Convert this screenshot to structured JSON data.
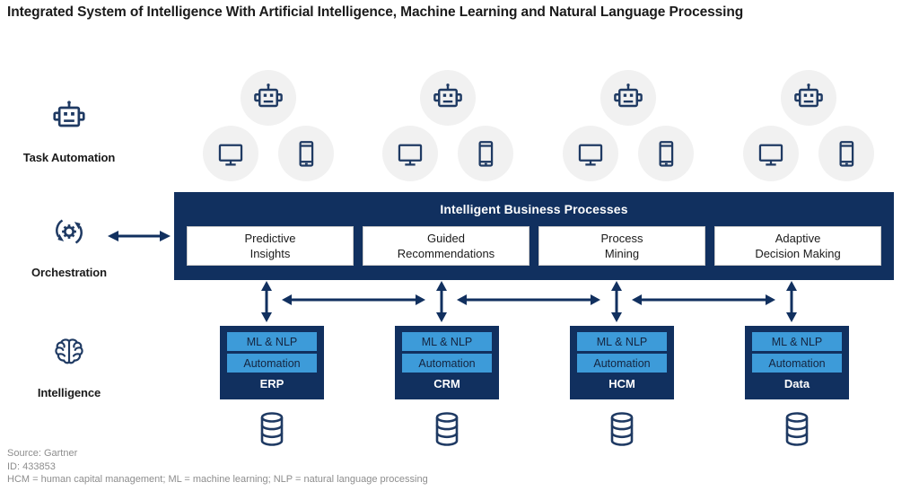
{
  "title": "Integrated System of Intelligence With Artificial Intelligence, Machine Learning and Natural Language Processing",
  "colors": {
    "navy": "#11305f",
    "light_blue": "#3d9bd9",
    "icon_navy": "#1f3a63",
    "circle_bg": "#f1f1f1",
    "footer_gray": "#8d8d8d"
  },
  "rows": [
    {
      "id": "task-automation",
      "label": "Task Automation",
      "icon": "robot-icon"
    },
    {
      "id": "orchestration",
      "label": "Orchestration",
      "icon": "gear-refresh-icon"
    },
    {
      "id": "intelligence",
      "label": "Intelligence",
      "icon": "brain-icon"
    }
  ],
  "device_clusters": [
    {
      "robot": "robot-icon",
      "monitor": "desktop-monitor-icon",
      "phone": "smartphone-icon"
    },
    {
      "robot": "robot-icon",
      "monitor": "desktop-monitor-icon",
      "phone": "smartphone-icon"
    },
    {
      "robot": "robot-icon",
      "monitor": "desktop-monitor-icon",
      "phone": "smartphone-icon"
    },
    {
      "robot": "robot-icon",
      "monitor": "desktop-monitor-icon",
      "phone": "smartphone-icon"
    }
  ],
  "banner": {
    "title": "Intelligent  Business Processes",
    "cards": [
      {
        "line1": "Predictive",
        "line2": "Insights"
      },
      {
        "line1": "Guided",
        "line2": "Recommendations"
      },
      {
        "line1": "Process",
        "line2": "Mining"
      },
      {
        "line1": "Adaptive",
        "line2": "Decision Making"
      }
    ]
  },
  "orchestration_connector": "bidirectional-arrow",
  "arrows": {
    "vertical": [
      "bidirectional-vertical-arrow",
      "bidirectional-vertical-arrow",
      "bidirectional-vertical-arrow",
      "bidirectional-vertical-arrow"
    ],
    "horizontal": [
      "bidirectional-horizontal-arrow",
      "bidirectional-horizontal-arrow",
      "bidirectional-horizontal-arrow"
    ]
  },
  "stacks": [
    {
      "chip1": "ML & NLP",
      "chip2": "Automation",
      "name": "ERP",
      "database": "database-icon"
    },
    {
      "chip1": "ML & NLP",
      "chip2": "Automation",
      "name": "CRM",
      "database": "database-icon"
    },
    {
      "chip1": "ML & NLP",
      "chip2": "Automation",
      "name": "HCM",
      "database": "database-icon"
    },
    {
      "chip1": "ML & NLP",
      "chip2": "Automation",
      "name": "Data",
      "database": "database-icon"
    }
  ],
  "footer": {
    "source": "Source: Gartner",
    "id": "ID: 433853",
    "legend": "HCM = human capital management; ML = machine learning; NLP = natural language processing"
  }
}
